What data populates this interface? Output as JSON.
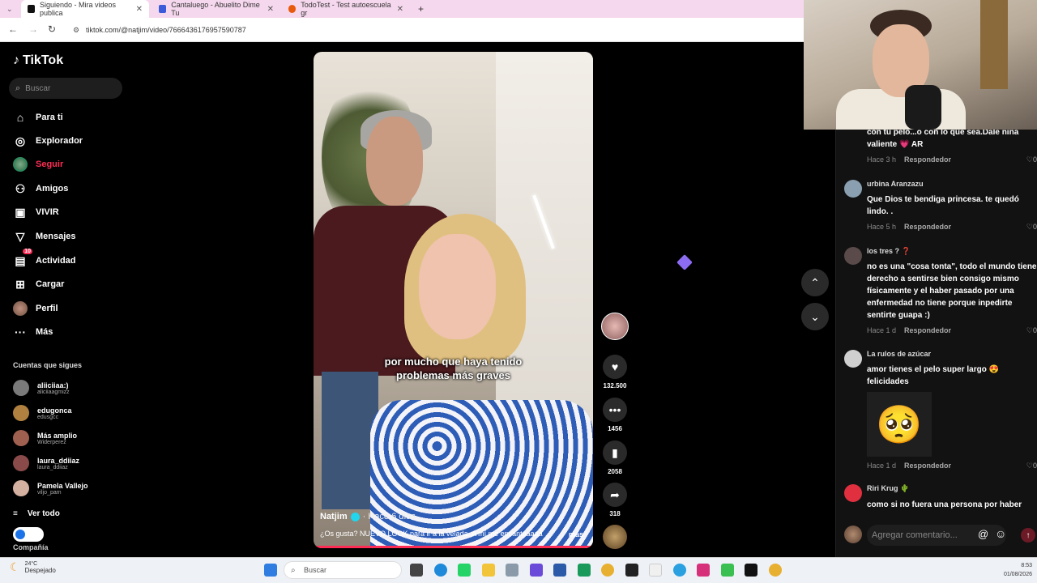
{
  "browser": {
    "tabs": [
      {
        "title": "Siguiendo - Mira videos publica",
        "color": "#111111"
      },
      {
        "title": "Cantaluego - Abuelito Dime Tu",
        "color": "#3b5bdb"
      },
      {
        "title": "TodoTest - Test autoescuela gr",
        "color": "#e8590c"
      }
    ],
    "new_tab": "+",
    "url": "tiktok.com/@natjim/video/7666436176957590787"
  },
  "sidebar": {
    "logo": "TikTok",
    "search_placeholder": "Buscar",
    "nav": [
      {
        "label": "Para ti",
        "icon": "home-icon",
        "glyph": "⌂"
      },
      {
        "label": "Explorador",
        "icon": "compass-icon",
        "glyph": "◎"
      },
      {
        "label": "Seguir",
        "icon": "following-avatar-icon",
        "glyph": "●"
      },
      {
        "label": "Amigos",
        "icon": "friends-icon",
        "glyph": "👥"
      },
      {
        "label": "VIVIR",
        "icon": "live-icon",
        "glyph": "▣"
      },
      {
        "label": "Mensajes",
        "icon": "messages-icon",
        "glyph": "▽"
      },
      {
        "label": "Actividad",
        "icon": "activity-icon",
        "glyph": "▤",
        "badge": "10"
      },
      {
        "label": "Cargar",
        "icon": "upload-icon",
        "glyph": "⊞"
      },
      {
        "label": "Perfil",
        "icon": "profile-icon",
        "glyph": "●"
      },
      {
        "label": "Más",
        "icon": "more-icon",
        "glyph": "···"
      }
    ],
    "following_title": "Cuentas que sigues",
    "following": [
      {
        "name": "aliiciiaa:)",
        "handle": "aliciiaagmizz",
        "color": "#7a7a7a"
      },
      {
        "name": "edugonca",
        "handle": "edusgcc",
        "color": "#b08040"
      },
      {
        "name": "Más amplio",
        "handle": "Widerperez",
        "color": "#a06050"
      },
      {
        "name": "laura_ddiiaz",
        "handle": "laura_ddiiaz",
        "color": "#8a4a4a"
      },
      {
        "name": "Pamela Vallejo",
        "handle": "viljo_pam",
        "color": "#d4b0a0"
      }
    ],
    "see_all": "Ver todo",
    "company": "Compañía"
  },
  "video": {
    "caption_line1": "por mucho que haya tenido",
    "caption_line2": "problemas más graves",
    "author": "Natjim",
    "time": "· Hace 6 días",
    "description": "¿Os gusta? NUEVO LOOK para ir a la velada. A mí me encantaaaaa",
    "more": "más"
  },
  "actions": {
    "likes": "132.500",
    "comments": "1456",
    "saves": "2058",
    "shares": "318"
  },
  "comments": [
    {
      "name": "",
      "text": "con tu pelo...o con lo que sea.Dale niña valiente 💗 AR",
      "time": "Hace 3 h",
      "reply": "Respondedor",
      "likes": "0",
      "avatar_color": "#000000"
    },
    {
      "name": "urbina Aranzazu",
      "text": "Que Dios te bendiga princesa. te quedó lindo. .",
      "time": "Hace 5 h",
      "reply": "Respondedor",
      "likes": "0",
      "avatar_color": "#8aa0b0"
    },
    {
      "name": "los tres ? ❓",
      "text": "no es una \"cosa tonta\", todo el mundo tiene derecho a sentirse bien consigo mismo físicamente y el haber pasado por una enfermedad no tiene porque inpedirte sentirte guapa :)",
      "time": "Hace 1 d",
      "reply": "Respondedor",
      "likes": "0",
      "avatar_color": "#5a4a4a"
    },
    {
      "name": "La rulos de azúcar",
      "text": "amor tienes el pelo super largo 😍 felicidades",
      "time": "Hace 1 d",
      "reply": "Respondedor",
      "likes": "0",
      "avatar_color": "#d0d0d0",
      "sticker": "🥺"
    },
    {
      "name": "Riri Krug 🌵",
      "text": "como si no fuera una persona por haber",
      "time": "",
      "reply": "",
      "likes": "",
      "avatar_color": "#e03040"
    }
  ],
  "add_comment": {
    "placeholder": "Agregar comentario...",
    "at": "@",
    "emoji": "☺",
    "send": "↑"
  },
  "taskbar": {
    "temp": "24°C",
    "weather": "Despejado",
    "search": "Buscar",
    "time": "8:53",
    "date": "01/08/2026"
  },
  "colors": {
    "accent": "#fe2c55",
    "verified": "#20d5ec"
  }
}
